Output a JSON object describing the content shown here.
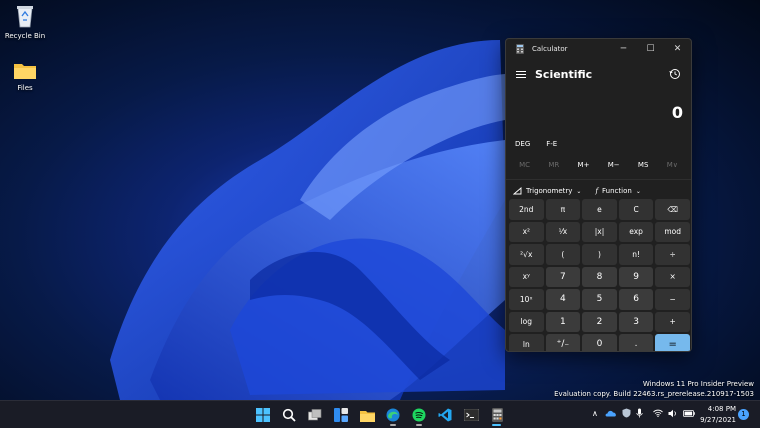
{
  "desktop": {
    "icons": [
      {
        "label": "Recycle Bin",
        "icon": "recycle-bin-icon"
      },
      {
        "label": "Files",
        "icon": "folder-icon"
      }
    ]
  },
  "calculator": {
    "window_title": "Calculator",
    "controls": {
      "minimize": "─",
      "maximize": "☐",
      "close": "✕"
    },
    "mode": "Scientific",
    "display_value": "0",
    "angle_unit": "DEG",
    "fe_label": "F-E",
    "memory": [
      "MC",
      "MR",
      "M+",
      "M−",
      "MS",
      "M∨"
    ],
    "trig_label": "Trigonometry",
    "function_label": "Function",
    "keys": [
      "2nd",
      "π",
      "e",
      "C",
      "⌫",
      "x²",
      "¹⁄x",
      "|x|",
      "exp",
      "mod",
      "²√x",
      "(",
      ")",
      "n!",
      "÷",
      "xʸ",
      "7",
      "8",
      "9",
      "×",
      "10ˣ",
      "4",
      "5",
      "6",
      "−",
      "log",
      "1",
      "2",
      "3",
      "+",
      "ln",
      "⁺∕₋",
      "0",
      ".",
      "="
    ],
    "equals_color": "#76b9ed"
  },
  "watermark": {
    "line1": "Windows 11 Pro Insider Preview",
    "line2": "Evaluation copy. Build 22463.rs_prerelease.210917-1503"
  },
  "taskbar": {
    "apps": [
      "start-icon",
      "search-icon",
      "task-view-icon",
      "widgets-icon",
      "file-explorer-icon",
      "edge-icon",
      "spotify-icon",
      "vscode-icon",
      "terminal-icon",
      "calculator-icon"
    ],
    "tray": {
      "chevron": "∧"
    },
    "time": "4:08 PM",
    "date": "9/27/2021",
    "notification_count": "1"
  }
}
